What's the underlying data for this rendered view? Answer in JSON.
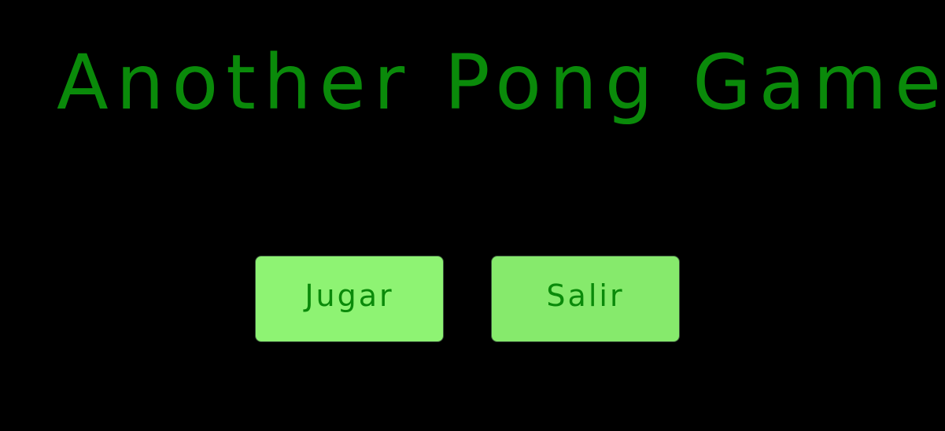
{
  "game": {
    "title": "Another Pong Game"
  },
  "menu": {
    "play_label": "Jugar",
    "quit_label": "Salir"
  },
  "colors": {
    "background": "#000000",
    "title": "#0a8a0a",
    "button_fill": "#8ef373",
    "button_text": "#0a8a0a"
  }
}
